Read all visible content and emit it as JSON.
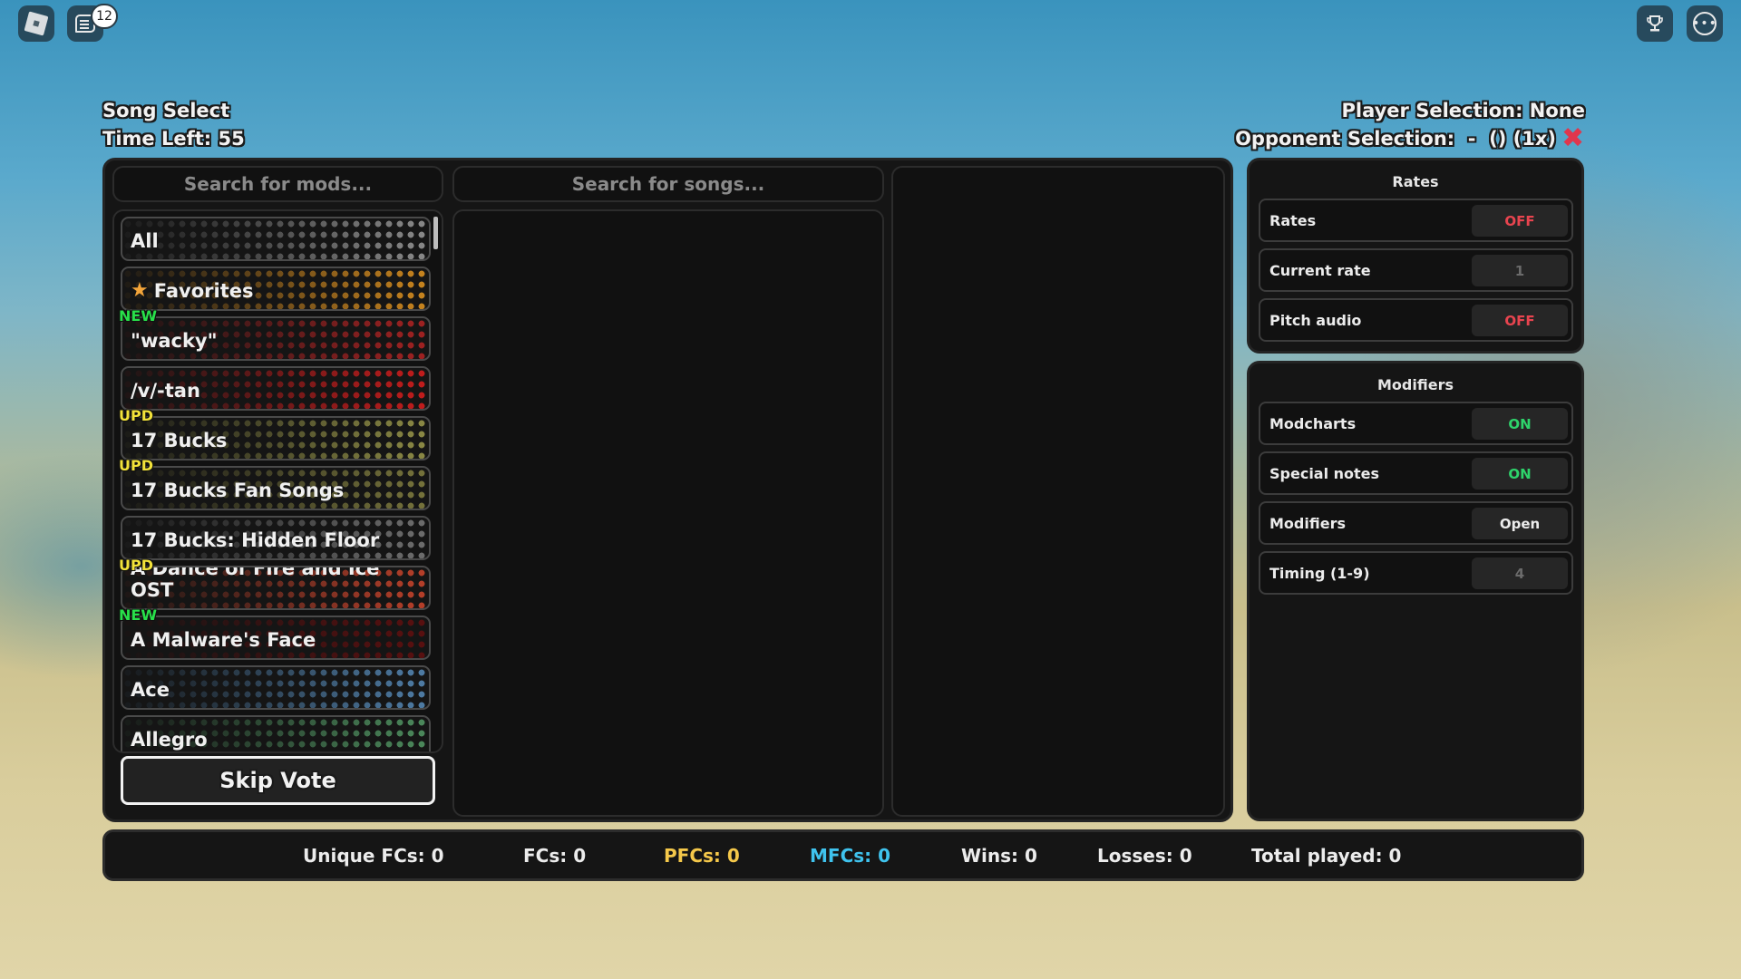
{
  "topbar": {
    "roblox_menu_icon": "roblox-logo-icon",
    "chat_icon": "chat-icon",
    "chat_badge": "12",
    "leaderboard_icon": "trophy-icon",
    "more_icon": "more-options-icon"
  },
  "header": {
    "title": "Song Select",
    "time_left": "Time Left: 55",
    "player_selection": "Player Selection: None",
    "opponent_selection": "Opponent Selection:  -  () (1x)",
    "clear_icon": "close-x-icon"
  },
  "mods": {
    "search_placeholder": "Search for mods...",
    "items": [
      {
        "label": "All",
        "tag": "",
        "color": "#8a8a8a"
      },
      {
        "label": "Favorites",
        "tag": "",
        "color": "#c9851f",
        "icon": "star-icon"
      },
      {
        "label": "\"wacky\"",
        "tag": "NEW",
        "color": "#a12222"
      },
      {
        "label": "/v/-tan",
        "tag": "",
        "color": "#c41d1d"
      },
      {
        "label": "17 Bucks",
        "tag": "UPD",
        "color": "#8c8a45"
      },
      {
        "label": "17 Bucks Fan Songs",
        "tag": "UPD",
        "color": "#77743c"
      },
      {
        "label": "17 Bucks: Hidden Floor",
        "tag": "",
        "color": "#6e6e6e"
      },
      {
        "label": "A Dance of Fire and Ice OST",
        "tag": "UPD",
        "color": "#b8402a"
      },
      {
        "label": "A Malware's Face",
        "tag": "NEW",
        "color": "#5a1010"
      },
      {
        "label": "Ace",
        "tag": "",
        "color": "#4f7da6"
      },
      {
        "label": "Allegro",
        "tag": "",
        "color": "#4c8a5c"
      }
    ],
    "tag_colors": {
      "NEW": "#28e04a",
      "UPD": "#f2e23a"
    }
  },
  "songs": {
    "search_placeholder": "Search for songs..."
  },
  "skip_vote_label": "Skip Vote",
  "rates_section": {
    "title": "Rates",
    "rows": [
      {
        "label": "Rates",
        "value": "OFF",
        "state": "off"
      },
      {
        "label": "Current rate",
        "value": "1",
        "state": "dim"
      },
      {
        "label": "Pitch audio",
        "value": "OFF",
        "state": "off"
      }
    ]
  },
  "modifiers_section": {
    "title": "Modifiers",
    "rows": [
      {
        "label": "Modcharts",
        "value": "ON",
        "state": "on"
      },
      {
        "label": "Special notes",
        "value": "ON",
        "state": "on"
      },
      {
        "label": "Modifiers",
        "value": "Open",
        "state": "neutral"
      },
      {
        "label": "Timing (1-9)",
        "value": "4",
        "state": "dim"
      }
    ]
  },
  "stats": [
    {
      "label": "Unique FCs: 0",
      "color": "#ececec"
    },
    {
      "label": "FCs: 0",
      "color": "#ececec"
    },
    {
      "label": "PFCs: 0",
      "color": "#f5c84a"
    },
    {
      "label": "MFCs: 0",
      "color": "#3fc3ee"
    },
    {
      "label": "Wins: 0",
      "color": "#ececec"
    },
    {
      "label": "Losses: 0",
      "color": "#ececec"
    },
    {
      "label": "Total played: 0",
      "color": "#ececec"
    }
  ]
}
